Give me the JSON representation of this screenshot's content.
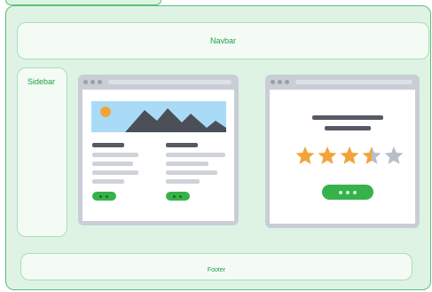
{
  "labels": {
    "navbar": "Navbar",
    "sidebar": "Sidebar",
    "footer": "Footer"
  },
  "rating": {
    "stars_filled": 3.5,
    "stars_total": 5
  },
  "colors": {
    "frame_fill": "#dff3e5",
    "frame_border": "#59bf79",
    "label_text": "#1f9c47",
    "browser_chrome": "#c9ced6",
    "star_filled": "#f2a43a",
    "star_empty": "#b8bec8",
    "button_green": "#36b24a",
    "sky": "#a9dbf7",
    "mountain": "#4a4f58",
    "sun": "#f2a43a"
  },
  "icons": [
    "mountain-image-icon",
    "sun-icon",
    "star-icon"
  ]
}
